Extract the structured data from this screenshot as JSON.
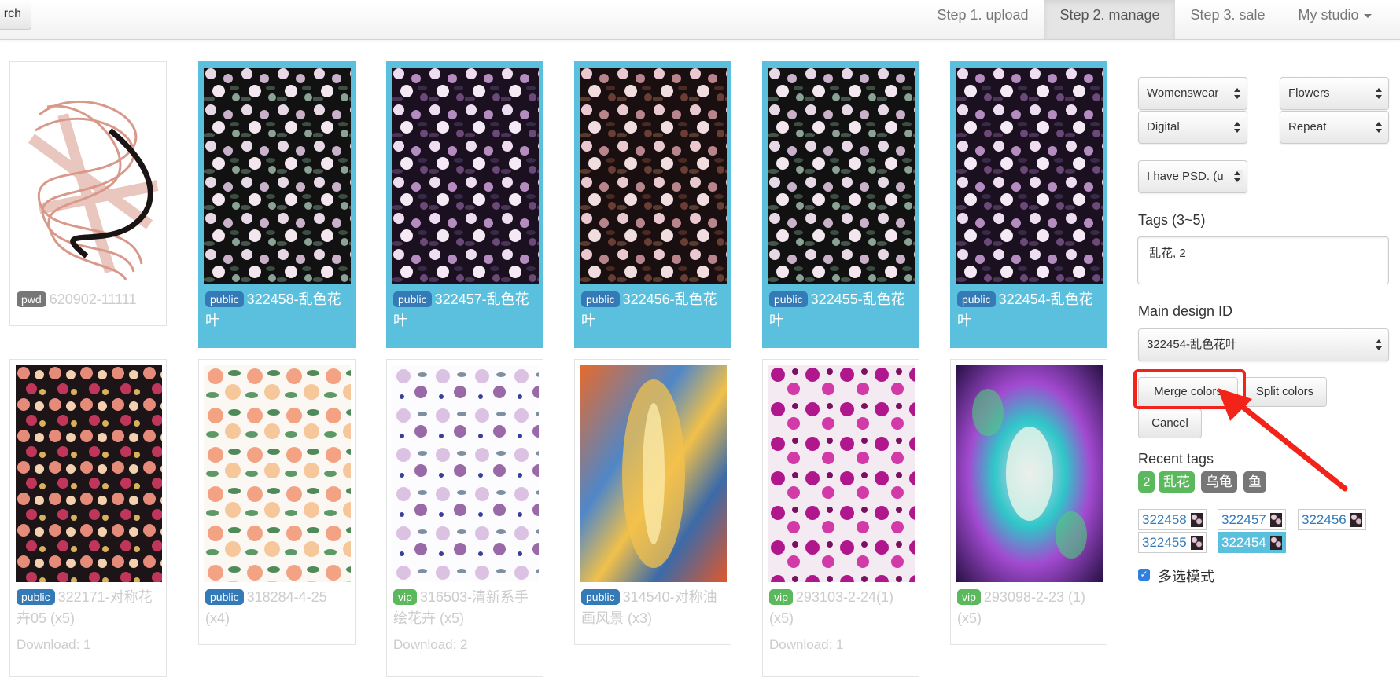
{
  "navbar": {
    "search_label": "rch",
    "items": [
      "Step 1. upload",
      "Step 2. manage",
      "Step 3. sale",
      "My studio"
    ],
    "active": "Step 2. manage"
  },
  "cards": [
    {
      "badge": "pwd",
      "title": "620902-11111",
      "download": "",
      "selected": false
    },
    {
      "badge": "public",
      "title": "322458-乱色花叶",
      "download": "",
      "selected": true
    },
    {
      "badge": "public",
      "title": "322457-乱色花叶",
      "download": "",
      "selected": true
    },
    {
      "badge": "public",
      "title": "322456-乱色花叶",
      "download": "",
      "selected": true
    },
    {
      "badge": "public",
      "title": "322455-乱色花叶",
      "download": "",
      "selected": true
    },
    {
      "badge": "public",
      "title": "322454-乱色花叶",
      "download": "",
      "selected": true
    },
    {
      "badge": "public",
      "title": "322171-对称花卉05 (x5)",
      "download": "Download: 1",
      "selected": false
    },
    {
      "badge": "public",
      "title": "318284-4-25 (x4)",
      "download": "",
      "selected": false
    },
    {
      "badge": "vip",
      "title": "316503-清新系手绘花卉 (x5)",
      "download": "Download: 2",
      "selected": false
    },
    {
      "badge": "public",
      "title": "314540-对称油画风景 (x3)",
      "download": "",
      "selected": false
    },
    {
      "badge": "vip",
      "title": "293103-2-24(1) (x5)",
      "download": "Download: 1",
      "selected": false
    },
    {
      "badge": "vip",
      "title": "293098-2-23 (1) (x5)",
      "download": "",
      "selected": false
    }
  ],
  "panel": {
    "selects": {
      "category": "Womenswear",
      "theme": "Flowers",
      "technique": "Digital",
      "layout": "Repeat",
      "psd": "I have PSD. (u"
    },
    "tags_label": "Tags (3~5)",
    "tags_value": "乱花, 2",
    "main_design_label": "Main design ID",
    "main_design_value": "322454-乱色花叶",
    "merge_label": "Merge colors",
    "split_label": "Split colors",
    "cancel_label": "Cancel",
    "recent_tags_label": "Recent tags",
    "recent_tags": [
      "2",
      "乱花",
      "乌龟",
      "鱼"
    ],
    "recent_tag_colors": [
      "#5cb85c",
      "#5cb85c",
      "#777777",
      "#777777"
    ],
    "chips": [
      "322458",
      "322457",
      "322456",
      "322455",
      "322454"
    ],
    "selected_chip": "322454",
    "multi_select_label": "多选模式",
    "multi_select_checked": true
  },
  "colors": {
    "selected": "#5bc0de",
    "public_badge": "#337ab7",
    "vip_badge": "#5cb85c",
    "pwd_badge": "#777777",
    "annotation": "#f2241a"
  }
}
